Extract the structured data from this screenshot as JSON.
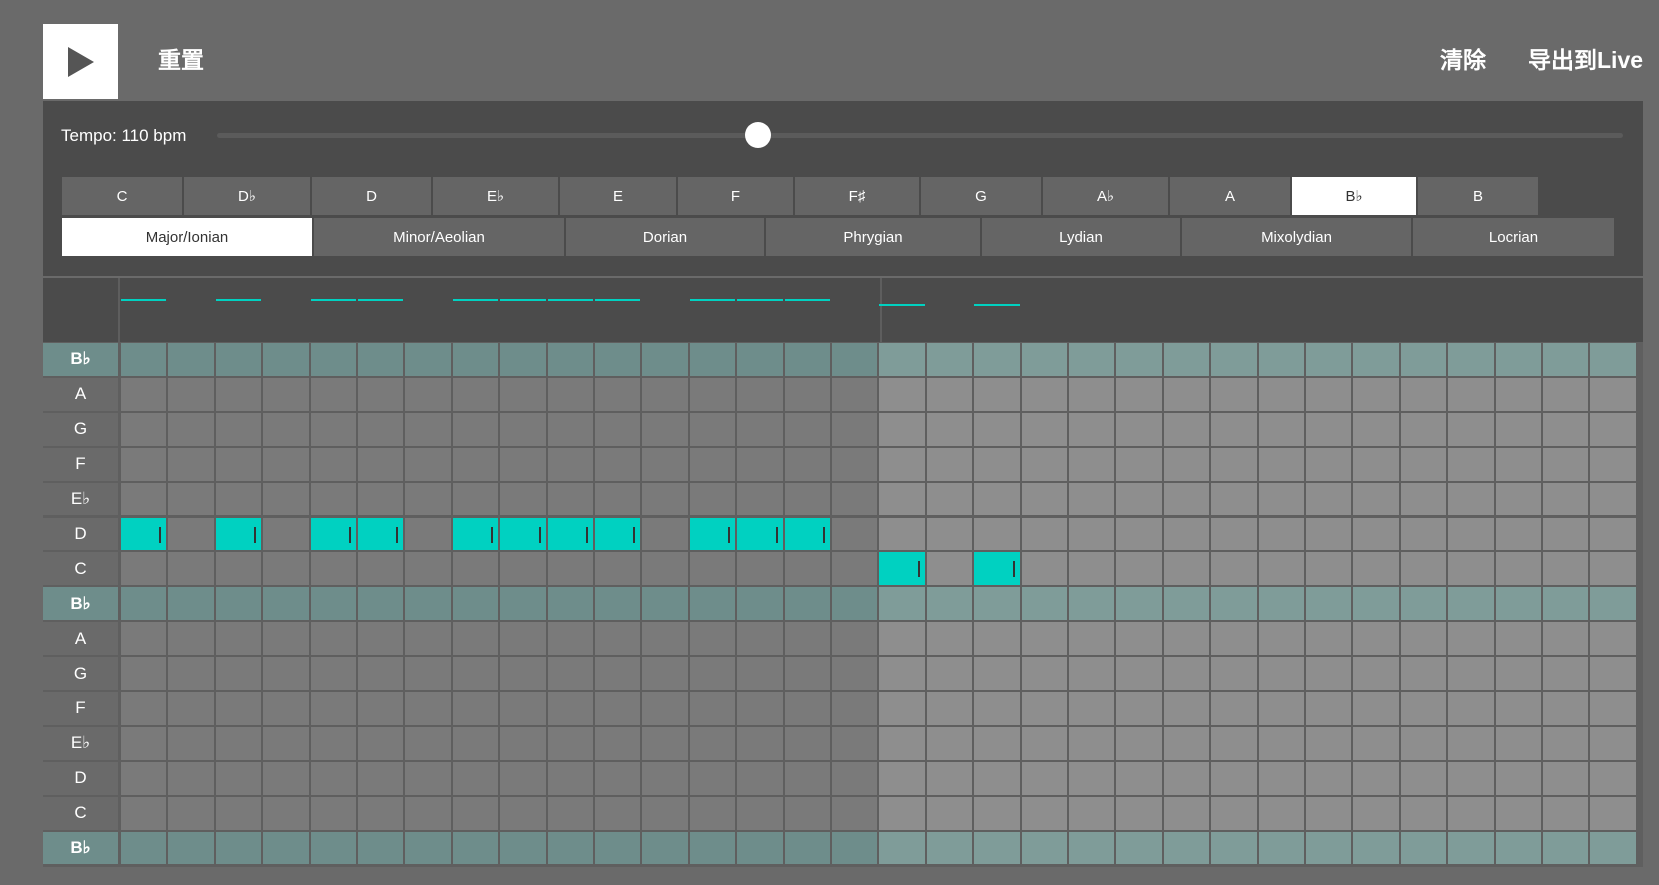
{
  "header": {
    "play_icon": "play-icon",
    "reset_label": "重置",
    "clear_label": "清除",
    "export_label": "导出到Live"
  },
  "tempo": {
    "label": "Tempo: 110 bpm",
    "bpm": 110,
    "slider_fraction": 0.385
  },
  "keys": {
    "items": [
      "C",
      "D♭",
      "D",
      "E♭",
      "E",
      "F",
      "F♯",
      "G",
      "A♭",
      "A",
      "B♭",
      "B"
    ],
    "selected": "B♭"
  },
  "modes": {
    "items": [
      "Major/Ionian",
      "Minor/Aeolian",
      "Dorian",
      "Phrygian",
      "Lydian",
      "Mixolydian",
      "Locrian"
    ],
    "selected": "Major/Ionian"
  },
  "colors": {
    "note": "#00d1c1",
    "root_row_played": "#6e8d8b",
    "root_row_future": "#7f9c99",
    "cell_played": "#7a7a7a",
    "cell_future": "#8e8e8e",
    "label_col": "#6a6a6a",
    "root_label_col": "#6e8d8b"
  },
  "grid": {
    "rows": [
      "B♭",
      "A",
      "G",
      "F",
      "E♭",
      "D",
      "C",
      "B♭",
      "A",
      "G",
      "F",
      "E♭",
      "D",
      "C",
      "B♭"
    ],
    "root_rows": [
      0,
      7,
      14
    ],
    "steps": 32,
    "played_steps": 16,
    "notes": [
      {
        "row": 5,
        "step": 0
      },
      {
        "row": 5,
        "step": 2
      },
      {
        "row": 5,
        "step": 4
      },
      {
        "row": 5,
        "step": 5
      },
      {
        "row": 5,
        "step": 7
      },
      {
        "row": 5,
        "step": 8
      },
      {
        "row": 5,
        "step": 9
      },
      {
        "row": 5,
        "step": 10
      },
      {
        "row": 5,
        "step": 12
      },
      {
        "row": 5,
        "step": 13
      },
      {
        "row": 5,
        "step": 14
      },
      {
        "row": 6,
        "step": 16
      },
      {
        "row": 6,
        "step": 18
      }
    ]
  }
}
